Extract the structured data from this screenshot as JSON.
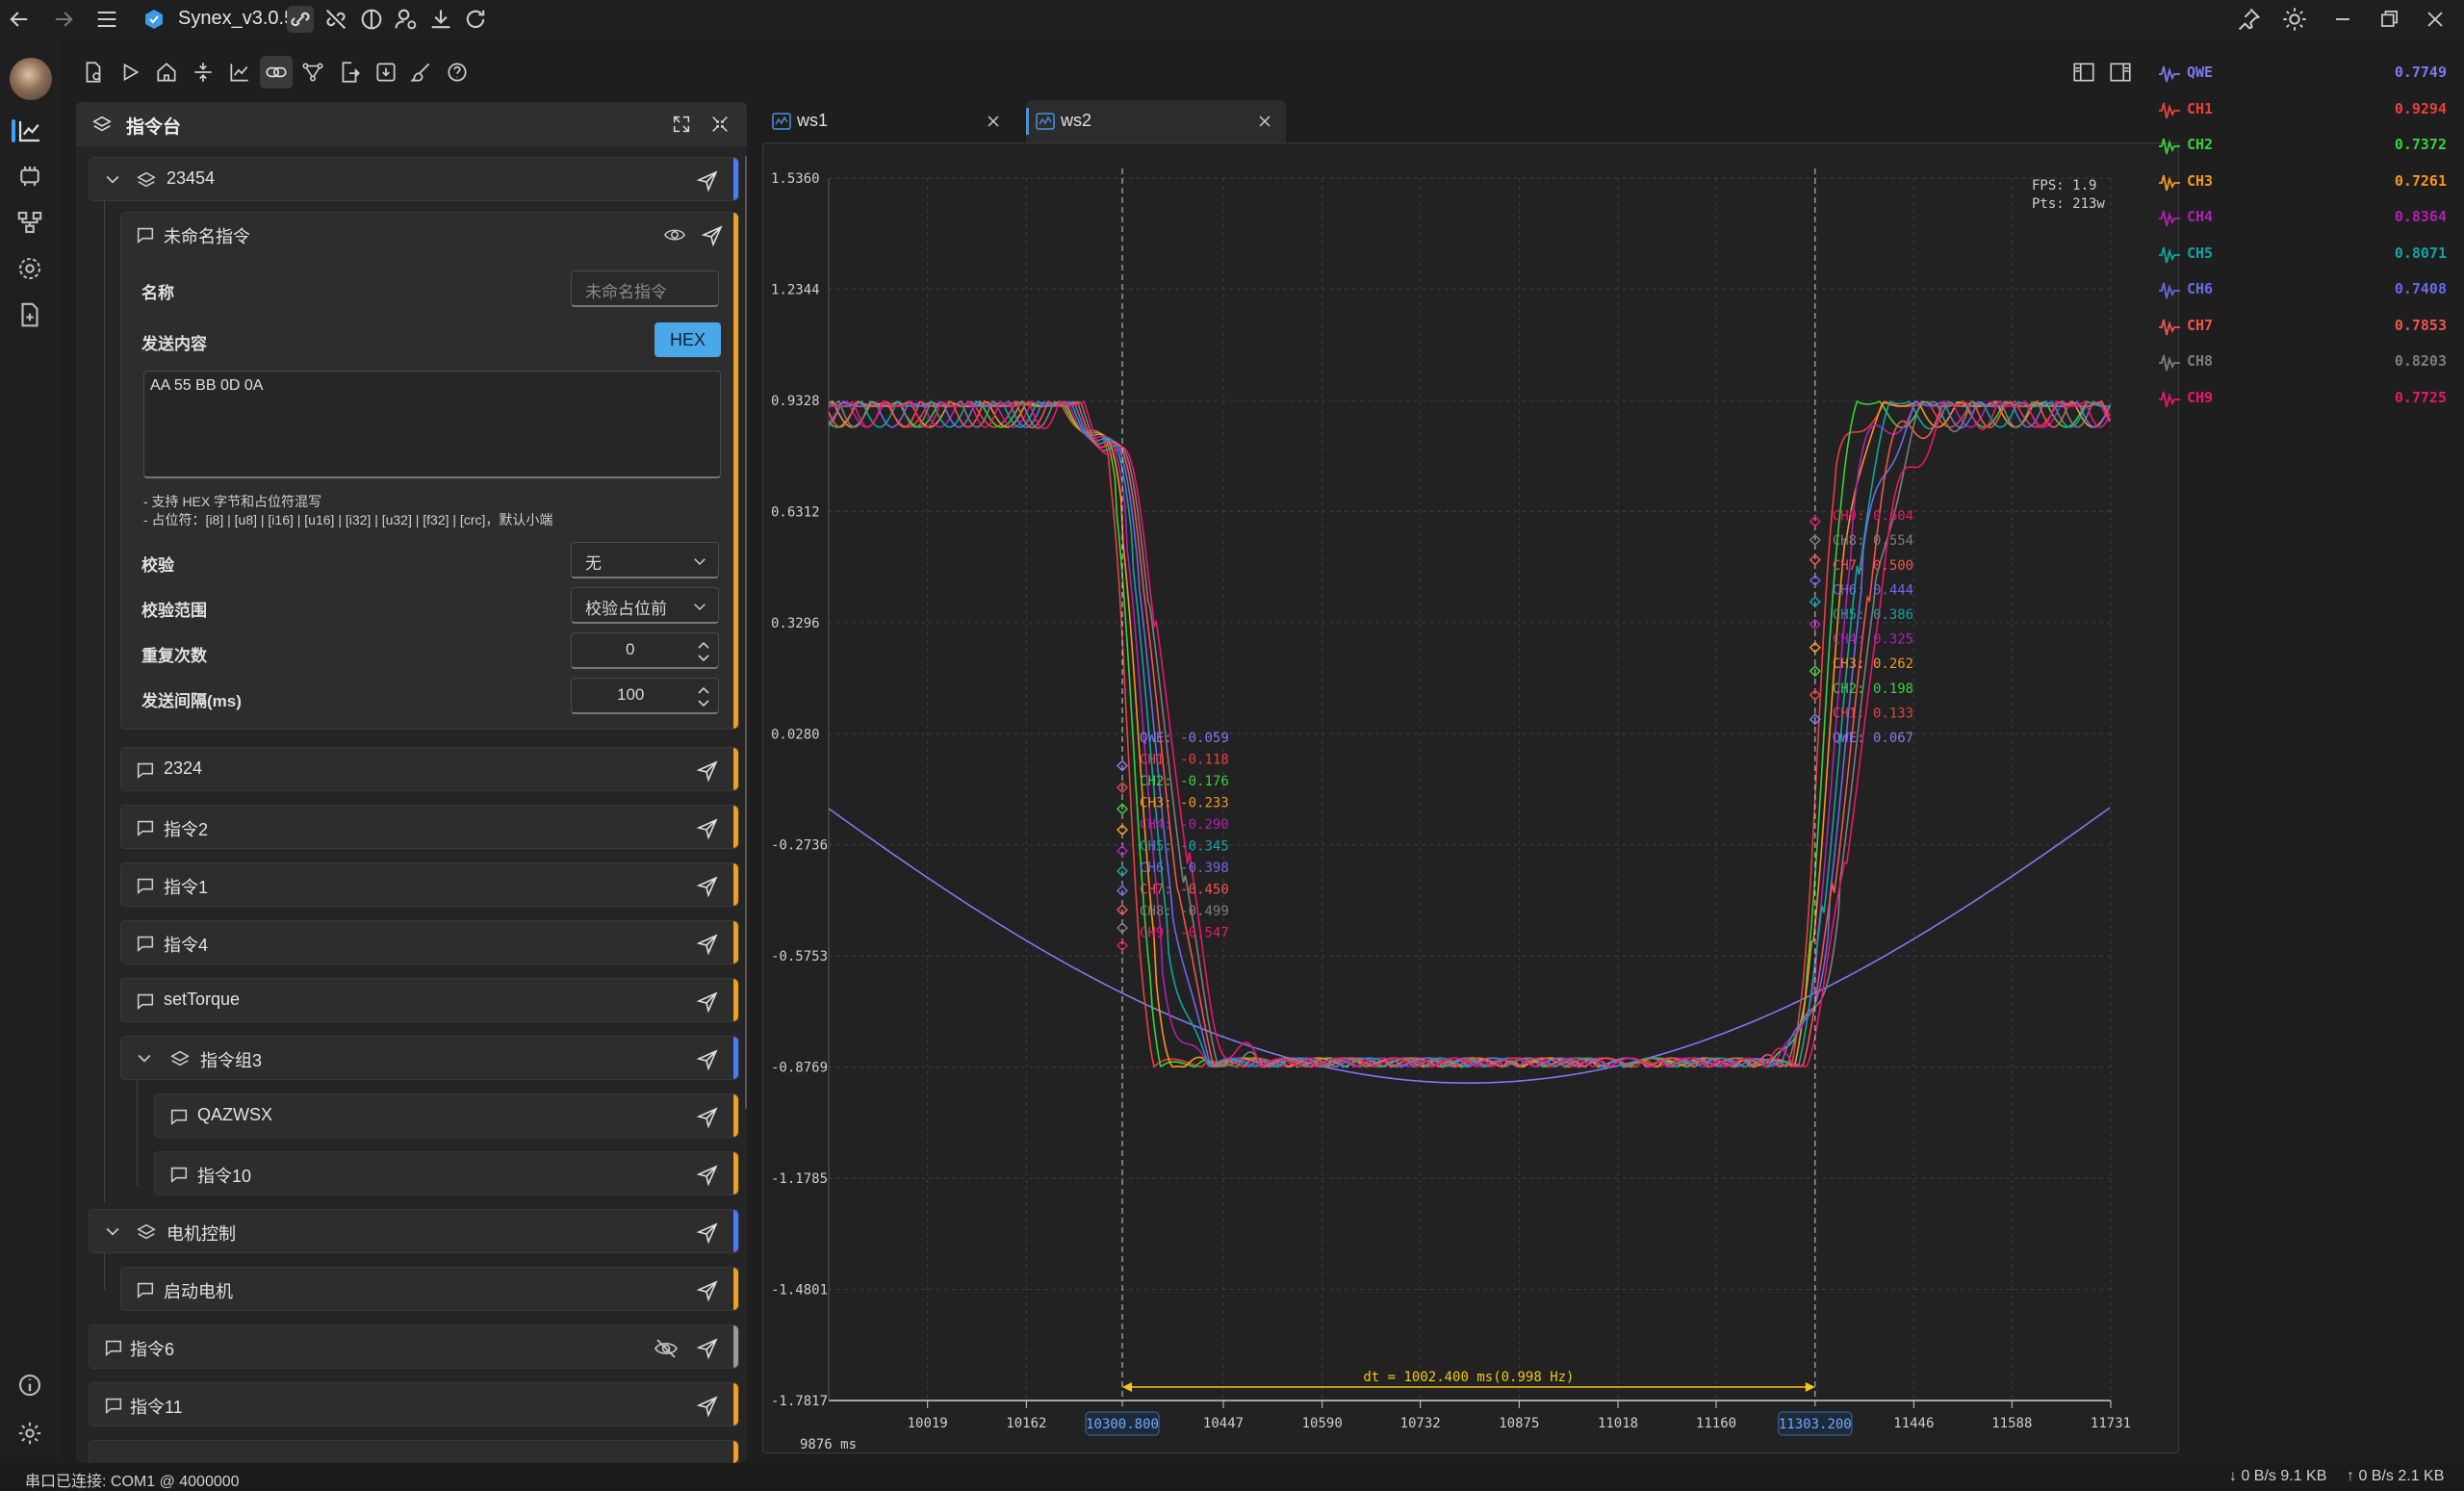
{
  "app": {
    "title": "Synex_v3.0.5"
  },
  "panel": {
    "title": "指令台",
    "root_group": "23454",
    "editor": {
      "name": "未命名指令",
      "name_label": "名称",
      "name_placeholder": "未命名指令",
      "content_label": "发送内容",
      "hex_button": "HEX",
      "content_value": "AA 55 BB 0D 0A",
      "hint1": "- 支持 HEX 字节和占位符混写",
      "hint2": "- 占位符：[i8] | [u8] | [i16] | [u16] | [i32] | [u32] | [f32] | [crc]，默认小端",
      "checksum_label": "校验",
      "checksum_value": "无",
      "range_label": "校验范围",
      "range_value": "校验占位前",
      "repeat_label": "重复次数",
      "repeat_value": "0",
      "interval_label": "发送间隔(ms)",
      "interval_value": "100"
    },
    "items": {
      "i2324": "2324",
      "cmd2": "指令2",
      "cmd1": "指令1",
      "cmd4": "指令4",
      "settorque": "setTorque",
      "group3": "指令组3",
      "qazwsx": "QAZWSX",
      "cmd10": "指令10",
      "motor_group": "电机控制",
      "start_motor": "启动电机",
      "cmd6": "指令6",
      "cmd11": "指令11"
    }
  },
  "tabs": [
    {
      "label": "ws1"
    },
    {
      "label": "ws2"
    }
  ],
  "chart_data": {
    "type": "line",
    "title": "",
    "xlabel": "",
    "ylabel": "",
    "x_unit": "ms",
    "x_origin_label": "9876 ms",
    "xlim": [
      9876,
      11731
    ],
    "ylim": [
      -1.7817,
      1.536
    ],
    "y_ticks": [
      "1.5360",
      "1.2344",
      "0.9328",
      "0.6312",
      "0.3296",
      "0.0280",
      "-0.2736",
      "-0.5753",
      "-0.8769",
      "-1.1785",
      "-1.4801",
      "-1.7817"
    ],
    "x_ticks": [
      "10019",
      "10162",
      "10447",
      "10590",
      "10732",
      "10875",
      "11018",
      "11160",
      "11446",
      "11588",
      "11731"
    ],
    "grid": true,
    "fps": "FPS: 1.9",
    "pts": "Pts: 213w",
    "cursor1": {
      "label": "10300.800"
    },
    "cursor2": {
      "label": "11303.200"
    },
    "dt_label": "dt = 1002.400 ms(0.998 Hz)",
    "series": [
      {
        "name": "QWE",
        "color": "#7b7bf0",
        "legend_value": "0.7749",
        "c1": "-0.059",
        "c2": "0.067"
      },
      {
        "name": "CH1",
        "color": "#e8403f",
        "legend_value": "0.9294",
        "c1": "-0.118",
        "c2": "0.133"
      },
      {
        "name": "CH2",
        "color": "#3ccf3c",
        "legend_value": "0.7372",
        "c1": "-0.176",
        "c2": "0.198"
      },
      {
        "name": "CH3",
        "color": "#f5961e",
        "legend_value": "0.7261",
        "c1": "-0.233",
        "c2": "0.262"
      },
      {
        "name": "CH4",
        "color": "#b21fb2",
        "legend_value": "0.8364",
        "c1": "-0.290",
        "c2": "0.325"
      },
      {
        "name": "CH5",
        "color": "#13a3a3",
        "legend_value": "0.8071",
        "c1": "-0.345",
        "c2": "0.386"
      },
      {
        "name": "CH6",
        "color": "#6a6ae8",
        "legend_value": "0.7408",
        "c1": "-0.398",
        "c2": "0.444"
      },
      {
        "name": "CH7",
        "color": "#f0554f",
        "legend_value": "0.7853",
        "c1": "-0.450",
        "c2": "0.500"
      },
      {
        "name": "CH8",
        "color": "#7d7d7d",
        "legend_value": "0.8203",
        "c1": "-0.499",
        "c2": "0.554"
      },
      {
        "name": "CH9",
        "color": "#e8176e",
        "legend_value": "0.7725",
        "c1": "-0.547",
        "c2": "0.604"
      }
    ]
  },
  "status": {
    "connection": "串口已连接: COM1 @ 4000000",
    "rx": "↓ 0 B/s 9.1 KB",
    "tx": "↑ 0 B/s 2.1 KB"
  }
}
